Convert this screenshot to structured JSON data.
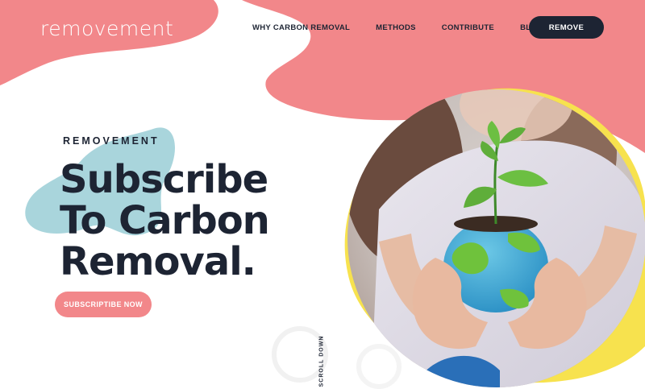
{
  "brand": {
    "logo_text": "removement"
  },
  "nav": {
    "items": [
      {
        "label": "WHY CARBON REMOVAL"
      },
      {
        "label": "METHODS"
      },
      {
        "label": "CONTRIBUTE"
      },
      {
        "label": "BLOG"
      }
    ],
    "cta_label": "REMOVE"
  },
  "hero": {
    "eyebrow": "REMOVEMENT",
    "title_lines": [
      "Subscribe",
      "To Carbon",
      "Removal."
    ],
    "button_label": "SUBSCRIPTIBE NOW",
    "scroll_label": "SCROLL DOWN",
    "image_icon": "child-holding-sprout-in-painted-eggshell-globe"
  },
  "colors": {
    "coral": "#f2878a",
    "navy": "#1d2433",
    "yellow": "#f7e24e",
    "light_blue": "#a9d5dc"
  }
}
